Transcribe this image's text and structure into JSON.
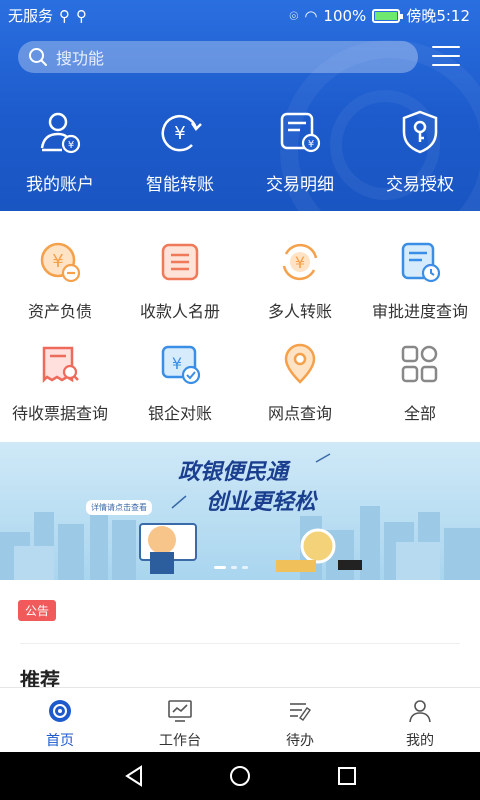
{
  "status": {
    "carrier": "无服务",
    "battery": "100%",
    "time": "傍晚5:12"
  },
  "search": {
    "placeholder": "搜功能"
  },
  "quick": [
    {
      "label": "我的账户",
      "icon": "account-icon"
    },
    {
      "label": "智能转账",
      "icon": "transfer-icon"
    },
    {
      "label": "交易明细",
      "icon": "detail-icon"
    },
    {
      "label": "交易授权",
      "icon": "shield-key-icon"
    }
  ],
  "services": [
    {
      "label": "资产负债",
      "icon": "yen-minus-icon"
    },
    {
      "label": "收款人名册",
      "icon": "list-icon"
    },
    {
      "label": "多人转账",
      "icon": "multi-transfer-icon"
    },
    {
      "label": "审批进度查询",
      "icon": "approval-icon"
    },
    {
      "label": "待收票据查询",
      "icon": "bill-search-icon"
    },
    {
      "label": "银企对账",
      "icon": "reconcile-icon"
    },
    {
      "label": "网点查询",
      "icon": "location-icon"
    },
    {
      "label": "全部",
      "icon": "all-icon"
    }
  ],
  "banner": {
    "line1": "政银便民通",
    "line2": "创业更轻松",
    "tag": "详情请点击查看"
  },
  "notice": {
    "label": "公告"
  },
  "recommend": {
    "title": "推荐"
  },
  "tabs": [
    {
      "label": "首页",
      "icon": "home-icon",
      "active": true
    },
    {
      "label": "工作台",
      "icon": "workbench-icon",
      "active": false
    },
    {
      "label": "待办",
      "icon": "todo-icon",
      "active": false
    },
    {
      "label": "我的",
      "icon": "user-icon",
      "active": false
    }
  ],
  "colors": {
    "primary": "#1d5bcc",
    "orange": "#f5a04a",
    "blue_icon": "#3a8ee6",
    "badge": "#f05a5a"
  }
}
